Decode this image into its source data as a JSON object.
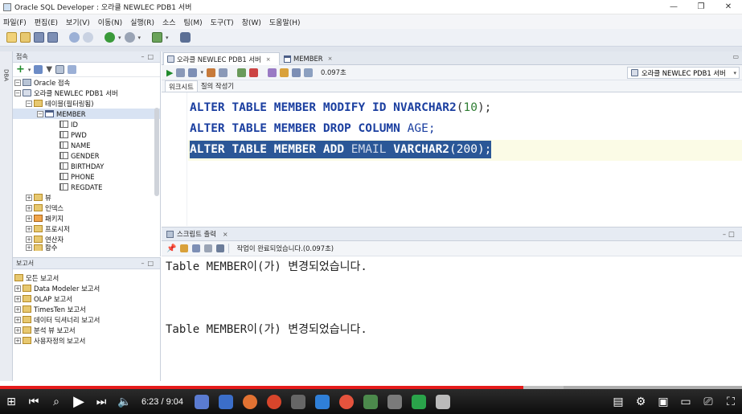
{
  "window": {
    "title": "Oracle SQL Developer : 오라클 NEWLEC PDB1 서버",
    "controls": [
      "—",
      "❐",
      "✕"
    ]
  },
  "menu": [
    "파일(F)",
    "편집(E)",
    "보기(V)",
    "이동(N)",
    "실행(R)",
    "소스",
    "팀(M)",
    "도구(T)",
    "창(W)",
    "도움말(H)"
  ],
  "connections_panel": {
    "title": "접속",
    "tree": [
      {
        "label": "Oracle 접속",
        "icon": "database-icon",
        "level": 0
      },
      {
        "label": "오라클 NEWLEC PDB1 서버",
        "icon": "connection-icon",
        "level": 1
      },
      {
        "label": "테이블(필터링됨)",
        "icon": "folder-icon",
        "level": 2
      },
      {
        "label": "MEMBER",
        "icon": "table-icon",
        "level": 3
      },
      {
        "label": "ID",
        "icon": "column-icon",
        "level": 4
      },
      {
        "label": "PWD",
        "icon": "column-icon",
        "level": 4
      },
      {
        "label": "NAME",
        "icon": "column-icon",
        "level": 4
      },
      {
        "label": "GENDER",
        "icon": "column-icon",
        "level": 4
      },
      {
        "label": "BIRTHDAY",
        "icon": "column-icon",
        "level": 4
      },
      {
        "label": "PHONE",
        "icon": "column-icon",
        "level": 4
      },
      {
        "label": "REGDATE",
        "icon": "column-icon",
        "level": 4
      },
      {
        "label": "뷰",
        "icon": "folder-icon",
        "level": 2
      },
      {
        "label": "인덱스",
        "icon": "folder-icon",
        "level": 2
      },
      {
        "label": "패키지",
        "icon": "package-icon",
        "level": 2
      },
      {
        "label": "프로시저",
        "icon": "folder-icon",
        "level": 2
      },
      {
        "label": "연산자",
        "icon": "folder-icon",
        "level": 2
      },
      {
        "label": "함수",
        "icon": "folder-icon",
        "level": 2
      }
    ]
  },
  "reports_panel": {
    "title": "보고서",
    "items": [
      "모든 보고서",
      "Data Modeler 보고서",
      "OLAP 보고서",
      "TimesTen 보고서",
      "데이터 딕셔너리 보고서",
      "분석 뷰 보고서",
      "사용자정의 보고서"
    ]
  },
  "editor": {
    "tabs": [
      "오라클 NEWLEC PDB1 서버",
      "MEMBER"
    ],
    "elapsed": "0.097초",
    "connection": "오라클 NEWLEC PDB1 서버",
    "subtabs": [
      "워크시트",
      "질의 작성기"
    ],
    "sql": {
      "l1": {
        "a": "ALTER TABLE MEMBER MODIFY ID ",
        "b": "NVARCHAR2",
        "c": "(",
        "d": "10",
        "e": ");"
      },
      "l2": {
        "a": "ALTER TABLE MEMBER DROP COLUMN ",
        "b": "AGE;"
      },
      "l3": {
        "a": "ALTER TABLE MEMBER ADD ",
        "b": "EMAIL ",
        "c": "VARCHAR2",
        "d": "(200);"
      }
    }
  },
  "output": {
    "title": "스크립트 출력",
    "status": "작업이 완료되었습니다.(0.097초)",
    "lines": [
      "Table MEMBER이(가) 변경되었습니다.",
      "Table MEMBER이(가) 변경되었습니다."
    ]
  },
  "video": {
    "time": "6:23 / 9:04",
    "progress": 0.705,
    "buffered": 0.76
  },
  "colors": {
    "keyword": "#1b3fa0",
    "number": "#2e7d32",
    "selection": "#2b5797",
    "progress": "#e51b1b"
  }
}
